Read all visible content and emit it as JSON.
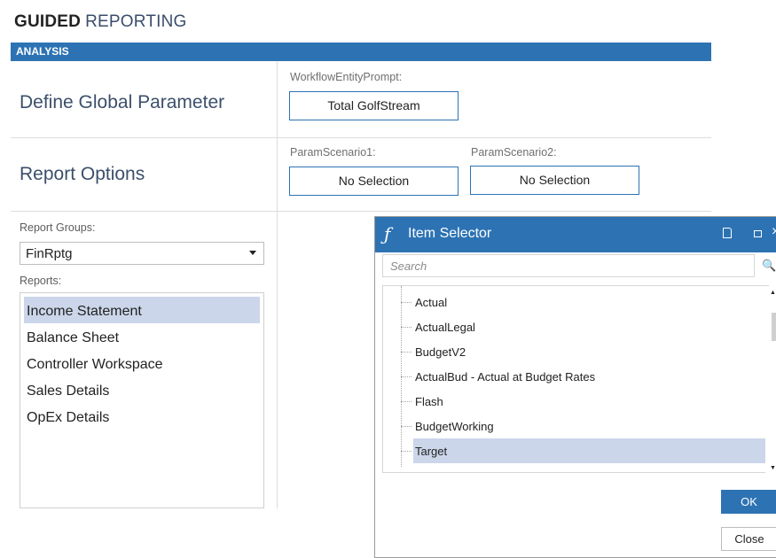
{
  "header": {
    "title_bold": "GUIDED",
    "title_rest": "REPORTING",
    "section": "ANALYSIS"
  },
  "params": {
    "global_label": "Define Global Parameter",
    "workflow_prompt_label": "WorkflowEntityPrompt:",
    "workflow_prompt_value": "Total GolfStream",
    "options_label": "Report Options",
    "scenario1_label": "ParamScenario1:",
    "scenario1_value": "No Selection",
    "scenario2_label": "ParamScenario2:",
    "scenario2_value": "No Selection"
  },
  "reports": {
    "groups_label": "Report Groups:",
    "group_selected": "FinRptg",
    "list_label": "Reports:",
    "items": [
      "Income Statement",
      "Balance Sheet",
      "Controller Workspace",
      "Sales Details",
      "OpEx Details"
    ],
    "selected_index": 0
  },
  "dialog": {
    "title": "Item Selector",
    "search_placeholder": "Search",
    "items": [
      "Actual",
      "ActualLegal",
      "BudgetV2",
      "ActualBud - Actual at Budget Rates",
      "Flash",
      "BudgetWorking",
      "Target"
    ],
    "selected_index": 6,
    "ok_label": "OK",
    "close_label": "Close",
    "logo_glyph": "ƒ",
    "close_glyph": "×"
  },
  "colors": {
    "accent": "#2d73b4",
    "selection": "#cbd6ea"
  }
}
